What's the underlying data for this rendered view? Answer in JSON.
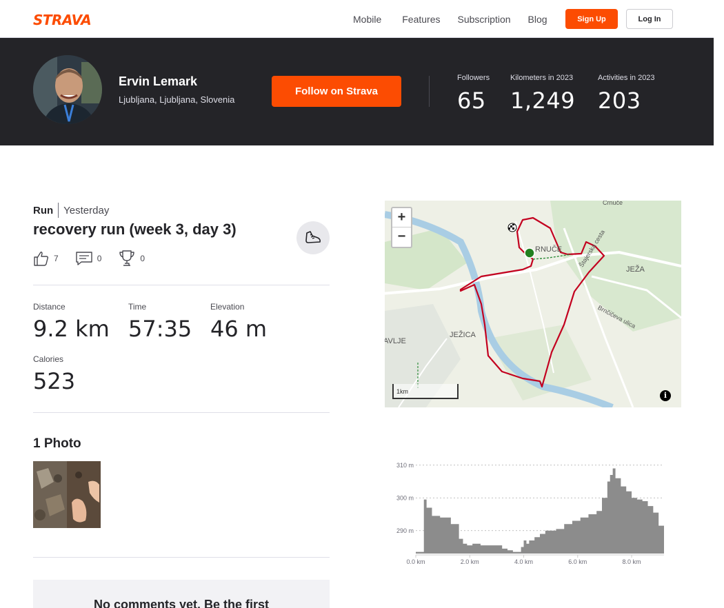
{
  "nav": {
    "logo": "STRAVA",
    "links": [
      "Mobile",
      "Features",
      "Subscription",
      "Blog"
    ],
    "signup": "Sign Up",
    "login": "Log In"
  },
  "athlete": {
    "name": "Ervin Lemark",
    "location": "Ljubljana, Ljubljana, Slovenia",
    "follow": "Follow on Strava",
    "stats": [
      {
        "label": "Followers",
        "value": "65"
      },
      {
        "label": "Kilometers in 2023",
        "value": "1,249"
      },
      {
        "label": "Activities in 2023",
        "value": "203"
      }
    ]
  },
  "activity": {
    "type": "Run",
    "date": "Yesterday",
    "title": "recovery run (week 3, day 3)",
    "kudos": "7",
    "comments": "0",
    "achievements": "0",
    "stats": [
      {
        "label": "Distance",
        "value": "9.2 km"
      },
      {
        "label": "Time",
        "value": "57:35"
      },
      {
        "label": "Elevation",
        "value": "46 m"
      },
      {
        "label": "Calories",
        "value": "523"
      }
    ],
    "photos_heading": "1 Photo",
    "comments_empty": "No comments yet. Be the first"
  },
  "map": {
    "zoom_in": "+",
    "zoom_out": "−",
    "scale": "1km",
    "info": "i",
    "labels": [
      "Črnuče",
      "RNUČE",
      "JEŽA",
      "Štajerska cesta",
      "Brnčičeva ulica",
      "JEŽICA",
      "AVLJE"
    ]
  },
  "chart_data": {
    "type": "area",
    "title": "",
    "xlabel": "",
    "ylabel": "",
    "x_ticks": [
      "0.0 km",
      "2.0 km",
      "4.0 km",
      "6.0 km",
      "8.0 km"
    ],
    "y_ticks": [
      "290 m",
      "300 m",
      "310 m"
    ],
    "xlim": [
      0,
      9.2
    ],
    "ylim": [
      283,
      311
    ],
    "x": [
      0,
      0.3,
      0.4,
      0.6,
      0.9,
      1.3,
      1.6,
      1.75,
      1.9,
      2.1,
      2.4,
      2.9,
      3.2,
      3.4,
      3.6,
      3.8,
      3.9,
      4.0,
      4.1,
      4.2,
      4.4,
      4.6,
      4.8,
      5.2,
      5.5,
      5.8,
      6.1,
      6.4,
      6.7,
      6.9,
      7.1,
      7.2,
      7.3,
      7.4,
      7.6,
      7.8,
      8.0,
      8.2,
      8.4,
      8.6,
      8.8,
      9.0,
      9.2
    ],
    "y": [
      283.5,
      299.5,
      297,
      294.5,
      294,
      292,
      287.5,
      286,
      285.5,
      286,
      285.5,
      285.5,
      284.5,
      284,
      283.5,
      283.5,
      285,
      287,
      286,
      287,
      288,
      289,
      290,
      290.5,
      292,
      293,
      294,
      295,
      296,
      300,
      305,
      307,
      309,
      306,
      303.5,
      302,
      300,
      299.5,
      299,
      297.5,
      295.5,
      291.5,
      291.5
    ]
  }
}
